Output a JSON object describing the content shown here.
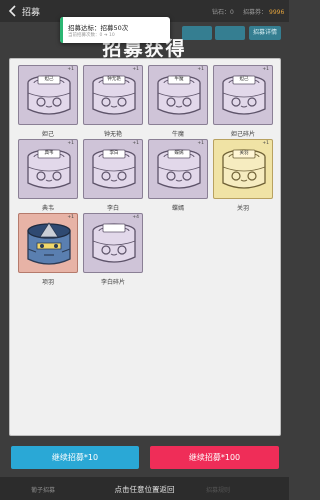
{
  "header": {
    "title": "招募",
    "diamond_label": "钻石：",
    "diamond_value": "0",
    "coin_label": "招募券：",
    "coin_value": "9996",
    "coin_color": "#e0a13c",
    "btn_a": "",
    "btn_b": "",
    "btn_c": "招募详情"
  },
  "toast": {
    "title": "招募达标：招募50次",
    "subtitle": "当前招募次数：0 ➔ 10"
  },
  "panel_title": "招募获得",
  "cards": [
    {
      "name": "妲己",
      "count": "+1",
      "badge": "妲己",
      "variant": "purple",
      "icon": "drum-icon"
    },
    {
      "name": "钟无艳",
      "count": "+1",
      "badge": "钟无艳",
      "variant": "purple",
      "icon": "drum-icon"
    },
    {
      "name": "牛魔",
      "count": "+1",
      "badge": "牛魔",
      "variant": "purple",
      "icon": "drum-icon"
    },
    {
      "name": "妲己碎片",
      "count": "+1",
      "badge": "妲己",
      "variant": "purple",
      "icon": "drum-icon"
    },
    {
      "name": "典韦",
      "count": "+1",
      "badge": "典韦",
      "variant": "purple",
      "icon": "drum-icon"
    },
    {
      "name": "李白",
      "count": "+1",
      "badge": "李白",
      "variant": "purple",
      "icon": "drum-icon"
    },
    {
      "name": "蝶嫣",
      "count": "+1",
      "badge": "蝶嫣",
      "variant": "purple",
      "icon": "drum-icon"
    },
    {
      "name": "关羽",
      "count": "+1",
      "badge": "关羽",
      "variant": "gold",
      "icon": "drum-icon"
    },
    {
      "name": "项羽",
      "count": "+1",
      "badge": "",
      "variant": "red",
      "icon": "warrior-drum-icon"
    },
    {
      "name": "李白碎片",
      "count": "+4",
      "badge": "",
      "variant": "purple",
      "icon": "drum-icon"
    }
  ],
  "buttons": {
    "continue_10": "继续招募*10",
    "continue_100": "继续招募*100",
    "blue_color": "#2aa8d6",
    "red_color": "#ef2d58"
  },
  "bottom": {
    "tab_left": "葡子招募",
    "hint": "点击任意位置返回",
    "tab_right": "招募规则"
  }
}
